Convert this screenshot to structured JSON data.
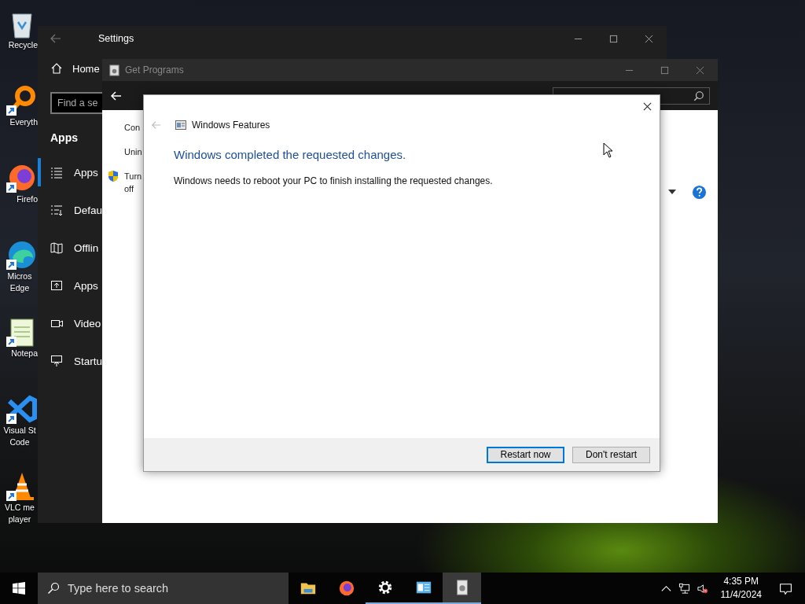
{
  "desktop_icons": [
    {
      "label": "Recycle",
      "kind": "recycle",
      "shortcut": false
    },
    {
      "label": "Everyth",
      "kind": "magnifier",
      "shortcut": true
    },
    {
      "label": "Firefo",
      "kind": "firefox",
      "shortcut": true
    },
    {
      "label": "Micros Edge",
      "kind": "edge",
      "shortcut": true
    },
    {
      "label": "Notepa",
      "kind": "notepad",
      "shortcut": true
    },
    {
      "label": "Visual St Code",
      "kind": "vscode",
      "shortcut": true
    },
    {
      "label": "VLC me player",
      "kind": "cone",
      "shortcut": true
    }
  ],
  "settings": {
    "title": "Settings",
    "home": "Home",
    "search_placeholder": "Find a se",
    "section": "Apps",
    "nav": [
      {
        "label": "Apps",
        "selected": true
      },
      {
        "label": "Defau",
        "selected": false
      },
      {
        "label": "Offlin",
        "selected": false
      },
      {
        "label": "Apps",
        "selected": false
      },
      {
        "label": "Video",
        "selected": false
      },
      {
        "label": "Startu",
        "selected": false
      }
    ]
  },
  "get_programs": {
    "title": "Get Programs",
    "links": [
      {
        "label": "Con",
        "shield": false
      },
      {
        "label": "Unin",
        "shield": false
      },
      {
        "label": "Turn off",
        "shield": true
      }
    ]
  },
  "dialog": {
    "title": "Windows Features",
    "heading": "Windows completed the requested changes.",
    "message": "Windows needs to reboot your PC to finish installing the requested changes.",
    "buttons": [
      {
        "label": "Restart now",
        "default": true
      },
      {
        "label": "Don't restart",
        "default": false
      }
    ]
  },
  "taskbar": {
    "search_placeholder": "Type here to search",
    "apps": [
      {
        "kind": "folder",
        "running": false,
        "selected": false
      },
      {
        "kind": "firefox",
        "running": false,
        "selected": false
      },
      {
        "kind": "gear",
        "running": true,
        "selected": false
      },
      {
        "kind": "panel",
        "running": true,
        "selected": false
      },
      {
        "kind": "programs",
        "running": true,
        "selected": true
      }
    ],
    "time": "4:35 PM",
    "date": "11/4/2024"
  }
}
